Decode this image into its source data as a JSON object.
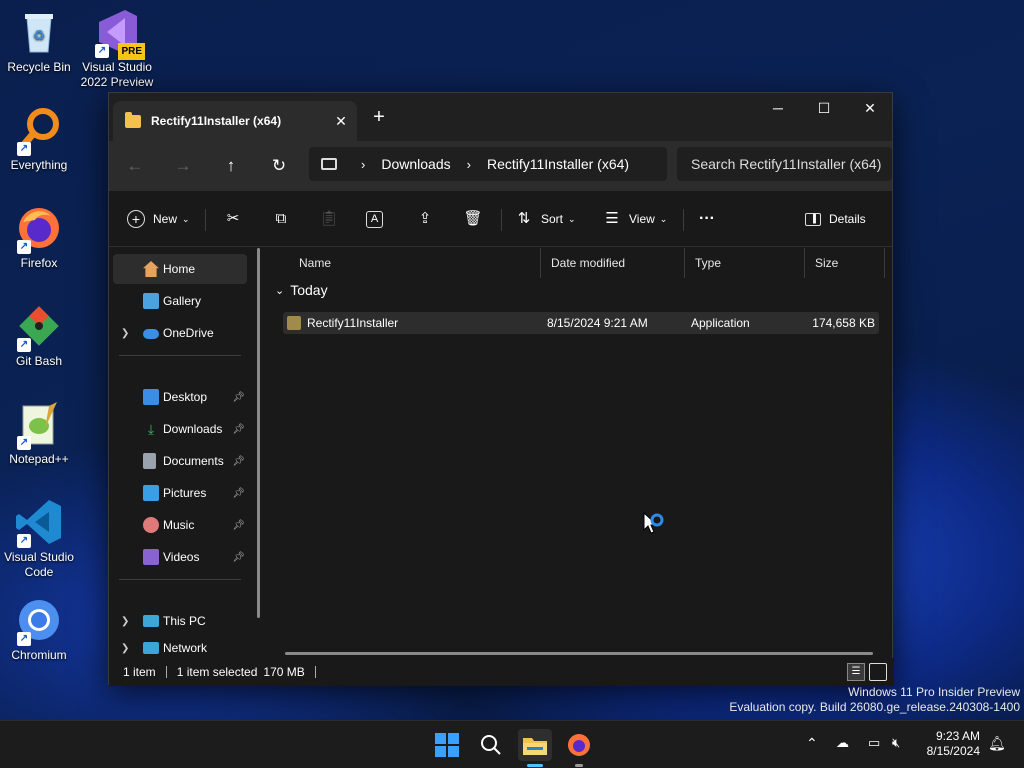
{
  "desktop": {
    "icons": [
      {
        "label": "Recycle Bin"
      },
      {
        "label": "Visual Studio 2022 Preview",
        "badge": "PRE"
      },
      {
        "label": "Everything"
      },
      {
        "label": "Firefox"
      },
      {
        "label": "Git Bash"
      },
      {
        "label": "Notepad++"
      },
      {
        "label": "Visual Studio Code"
      },
      {
        "label": "Chromium"
      }
    ],
    "watermark_line1": "Windows 11 Pro Insider Preview",
    "watermark_line2": "Evaluation copy. Build 26080.ge_release.240308-1400"
  },
  "explorer": {
    "tab_title": "Rectify11Installer (x64)",
    "breadcrumb": [
      "Downloads",
      "Rectify11Installer (x64)"
    ],
    "search_placeholder": "Search Rectify11Installer (x64)",
    "toolbar": {
      "new": "New",
      "sort": "Sort",
      "view": "View",
      "details": "Details"
    },
    "sidebar": {
      "top": [
        {
          "label": "Home"
        },
        {
          "label": "Gallery"
        },
        {
          "label": "OneDrive"
        }
      ],
      "pinned": [
        {
          "label": "Desktop"
        },
        {
          "label": "Downloads"
        },
        {
          "label": "Documents"
        },
        {
          "label": "Pictures"
        },
        {
          "label": "Music"
        },
        {
          "label": "Videos"
        }
      ],
      "bottom": [
        {
          "label": "This PC"
        },
        {
          "label": "Network"
        }
      ]
    },
    "columns": {
      "name": "Name",
      "date": "Date modified",
      "type": "Type",
      "size": "Size"
    },
    "group": "Today",
    "files": [
      {
        "name": "Rectify11Installer",
        "date": "8/15/2024 9:21 AM",
        "type": "Application",
        "size": "174,658 KB"
      }
    ],
    "status": {
      "count": "1 item",
      "selected": "1 item selected",
      "size": "170 MB"
    }
  },
  "taskbar": {
    "time": "9:23 AM",
    "date": "8/15/2024"
  },
  "colors": {
    "accent": "#4cc2ff",
    "folder": "#f2c14e",
    "taskbar": "#1c1c1c"
  }
}
